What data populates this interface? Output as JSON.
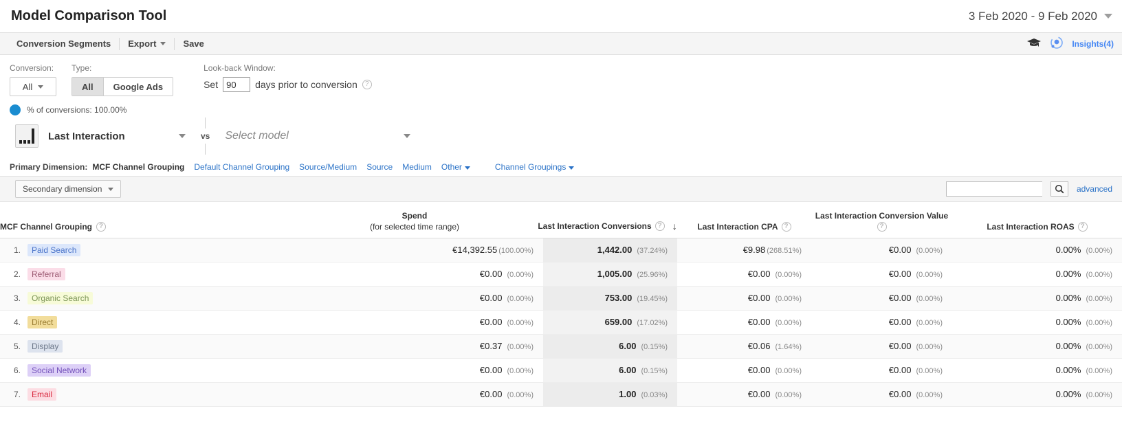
{
  "header": {
    "title": "Model Comparison Tool",
    "date_range": "3 Feb 2020 - 9 Feb 2020",
    "date_caret_icon": "chevron-down-icon"
  },
  "actionbar": {
    "items": [
      {
        "label": "Conversion Segments",
        "caret": false
      },
      {
        "label": "Export",
        "caret": true
      },
      {
        "label": "Save",
        "caret": false
      }
    ],
    "education_icon": "graduation-cap-icon",
    "insights_icon": "insights-icon",
    "insights_label": "Insights(4)"
  },
  "controls": {
    "conversion_label": "Conversion:",
    "conversion_value": "All",
    "type_label": "Type:",
    "type_options": [
      {
        "label": "All",
        "active": true
      },
      {
        "label": "Google Ads",
        "active": false
      }
    ],
    "lookback_label": "Look-back Window:",
    "lookback_prefix": "Set",
    "lookback_days": "90",
    "lookback_suffix": "days prior to conversion",
    "lookback_help_icon": "help-icon",
    "conversions_dot_color": "#1a8cd0",
    "conversions_pct_text": "% of conversions: 100.00%"
  },
  "model_compare": {
    "model_icon": "last-interaction-bars-icon",
    "model_a": "Last Interaction",
    "vs_label": "vs",
    "model_b_placeholder": "Select model",
    "caret_icon": "chevron-down-icon"
  },
  "primary_dimension": {
    "label": "Primary Dimension:",
    "active": "MCF Channel Grouping",
    "links": [
      {
        "label": "Default Channel Grouping",
        "caret": false
      },
      {
        "label": "Source/Medium",
        "caret": false
      },
      {
        "label": "Source",
        "caret": false
      },
      {
        "label": "Medium",
        "caret": false
      },
      {
        "label": "Other",
        "caret": true
      }
    ],
    "channel_groupings": {
      "label": "Channel Groupings",
      "caret": true
    }
  },
  "subbar": {
    "secondary_dimension_label": "Secondary dimension",
    "search_value": "",
    "search_placeholder": "",
    "search_icon": "search-icon",
    "advanced_label": "advanced"
  },
  "table": {
    "columns": {
      "dimension": {
        "label": "MCF Channel Grouping",
        "help_icon": "help-icon"
      },
      "spend": {
        "label": "Spend",
        "sublabel": "(for selected time range)"
      },
      "conversions": {
        "label": "Last Interaction Conversions",
        "help_icon": "help-icon",
        "sort_icon": "sort-desc-arrow-icon"
      },
      "cpa": {
        "label": "Last Interaction CPA",
        "help_icon": "help-icon"
      },
      "conversion_value": {
        "label": "Last Interaction Conversion Value",
        "help_icon": "help-icon"
      },
      "roas": {
        "label": "Last Interaction ROAS",
        "help_icon": "help-icon"
      }
    },
    "rows": [
      {
        "index": "1.",
        "channel": "Paid Search",
        "chip_bg": "#dce7fb",
        "chip_fg": "#4a73c9",
        "spend": "€14,392.55",
        "spend_pct": "(100.00%)",
        "spend_tight": true,
        "conversions": "1,442.00",
        "conversions_pct": "(37.24%)",
        "cpa": "€9.98",
        "cpa_pct": "(268.51%)",
        "cpa_tight": true,
        "conv_value": "€0.00",
        "conv_value_pct": "(0.00%)",
        "roas": "0.00%",
        "roas_pct": "(0.00%)"
      },
      {
        "index": "2.",
        "channel": "Referral",
        "chip_bg": "#fbdde8",
        "chip_fg": "#9c5a72",
        "spend": "€0.00",
        "spend_pct": "(0.00%)",
        "spend_tight": false,
        "conversions": "1,005.00",
        "conversions_pct": "(25.96%)",
        "cpa": "€0.00",
        "cpa_pct": "(0.00%)",
        "cpa_tight": false,
        "conv_value": "€0.00",
        "conv_value_pct": "(0.00%)",
        "roas": "0.00%",
        "roas_pct": "(0.00%)"
      },
      {
        "index": "3.",
        "channel": "Organic Search",
        "chip_bg": "#f7fbd8",
        "chip_fg": "#7b9455",
        "spend": "€0.00",
        "spend_pct": "(0.00%)",
        "spend_tight": false,
        "conversions": "753.00",
        "conversions_pct": "(19.45%)",
        "cpa": "€0.00",
        "cpa_pct": "(0.00%)",
        "cpa_tight": false,
        "conv_value": "€0.00",
        "conv_value_pct": "(0.00%)",
        "roas": "0.00%",
        "roas_pct": "(0.00%)"
      },
      {
        "index": "4.",
        "channel": "Direct",
        "chip_bg": "#f2dd9b",
        "chip_fg": "#9a7d32",
        "spend": "€0.00",
        "spend_pct": "(0.00%)",
        "spend_tight": false,
        "conversions": "659.00",
        "conversions_pct": "(17.02%)",
        "cpa": "€0.00",
        "cpa_pct": "(0.00%)",
        "cpa_tight": false,
        "conv_value": "€0.00",
        "conv_value_pct": "(0.00%)",
        "roas": "0.00%",
        "roas_pct": "(0.00%)"
      },
      {
        "index": "5.",
        "channel": "Display",
        "chip_bg": "#dde3ee",
        "chip_fg": "#6a7587",
        "spend": "€0.37",
        "spend_pct": "(0.00%)",
        "spend_tight": false,
        "conversions": "6.00",
        "conversions_pct": "(0.15%)",
        "cpa": "€0.06",
        "cpa_pct": "(1.64%)",
        "cpa_tight": false,
        "conv_value": "€0.00",
        "conv_value_pct": "(0.00%)",
        "roas": "0.00%",
        "roas_pct": "(0.00%)"
      },
      {
        "index": "6.",
        "channel": "Social Network",
        "chip_bg": "#ddd0f7",
        "chip_fg": "#7351ba",
        "spend": "€0.00",
        "spend_pct": "(0.00%)",
        "spend_tight": false,
        "conversions": "6.00",
        "conversions_pct": "(0.15%)",
        "cpa": "€0.00",
        "cpa_pct": "(0.00%)",
        "cpa_tight": false,
        "conv_value": "€0.00",
        "conv_value_pct": "(0.00%)",
        "roas": "0.00%",
        "roas_pct": "(0.00%)"
      },
      {
        "index": "7.",
        "channel": "Email",
        "chip_bg": "#fcdde3",
        "chip_fg": "#d8263c",
        "spend": "€0.00",
        "spend_pct": "(0.00%)",
        "spend_tight": false,
        "conversions": "1.00",
        "conversions_pct": "(0.03%)",
        "cpa": "€0.00",
        "cpa_pct": "(0.00%)",
        "cpa_tight": false,
        "conv_value": "€0.00",
        "conv_value_pct": "(0.00%)",
        "roas": "0.00%",
        "roas_pct": "(0.00%)"
      }
    ]
  }
}
